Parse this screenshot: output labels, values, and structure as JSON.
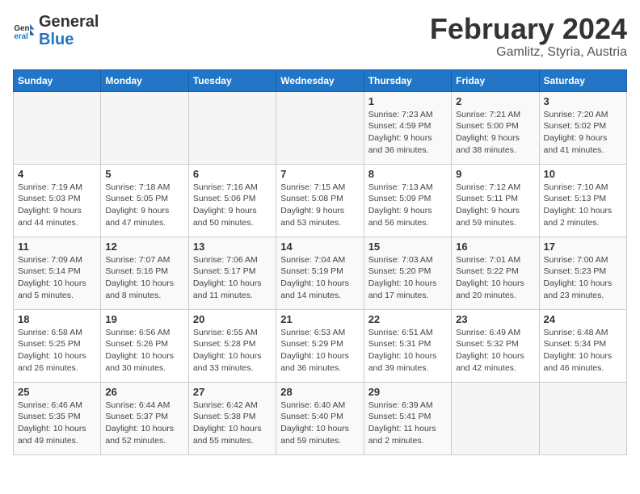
{
  "header": {
    "logo_line1": "General",
    "logo_line2": "Blue",
    "main_title": "February 2024",
    "sub_title": "Gamlitz, Styria, Austria"
  },
  "columns": [
    "Sunday",
    "Monday",
    "Tuesday",
    "Wednesday",
    "Thursday",
    "Friday",
    "Saturday"
  ],
  "weeks": [
    [
      {
        "day": "",
        "info": ""
      },
      {
        "day": "",
        "info": ""
      },
      {
        "day": "",
        "info": ""
      },
      {
        "day": "",
        "info": ""
      },
      {
        "day": "1",
        "info": "Sunrise: 7:23 AM\nSunset: 4:59 PM\nDaylight: 9 hours and 36 minutes."
      },
      {
        "day": "2",
        "info": "Sunrise: 7:21 AM\nSunset: 5:00 PM\nDaylight: 9 hours and 38 minutes."
      },
      {
        "day": "3",
        "info": "Sunrise: 7:20 AM\nSunset: 5:02 PM\nDaylight: 9 hours and 41 minutes."
      }
    ],
    [
      {
        "day": "4",
        "info": "Sunrise: 7:19 AM\nSunset: 5:03 PM\nDaylight: 9 hours and 44 minutes."
      },
      {
        "day": "5",
        "info": "Sunrise: 7:18 AM\nSunset: 5:05 PM\nDaylight: 9 hours and 47 minutes."
      },
      {
        "day": "6",
        "info": "Sunrise: 7:16 AM\nSunset: 5:06 PM\nDaylight: 9 hours and 50 minutes."
      },
      {
        "day": "7",
        "info": "Sunrise: 7:15 AM\nSunset: 5:08 PM\nDaylight: 9 hours and 53 minutes."
      },
      {
        "day": "8",
        "info": "Sunrise: 7:13 AM\nSunset: 5:09 PM\nDaylight: 9 hours and 56 minutes."
      },
      {
        "day": "9",
        "info": "Sunrise: 7:12 AM\nSunset: 5:11 PM\nDaylight: 9 hours and 59 minutes."
      },
      {
        "day": "10",
        "info": "Sunrise: 7:10 AM\nSunset: 5:13 PM\nDaylight: 10 hours and 2 minutes."
      }
    ],
    [
      {
        "day": "11",
        "info": "Sunrise: 7:09 AM\nSunset: 5:14 PM\nDaylight: 10 hours and 5 minutes."
      },
      {
        "day": "12",
        "info": "Sunrise: 7:07 AM\nSunset: 5:16 PM\nDaylight: 10 hours and 8 minutes."
      },
      {
        "day": "13",
        "info": "Sunrise: 7:06 AM\nSunset: 5:17 PM\nDaylight: 10 hours and 11 minutes."
      },
      {
        "day": "14",
        "info": "Sunrise: 7:04 AM\nSunset: 5:19 PM\nDaylight: 10 hours and 14 minutes."
      },
      {
        "day": "15",
        "info": "Sunrise: 7:03 AM\nSunset: 5:20 PM\nDaylight: 10 hours and 17 minutes."
      },
      {
        "day": "16",
        "info": "Sunrise: 7:01 AM\nSunset: 5:22 PM\nDaylight: 10 hours and 20 minutes."
      },
      {
        "day": "17",
        "info": "Sunrise: 7:00 AM\nSunset: 5:23 PM\nDaylight: 10 hours and 23 minutes."
      }
    ],
    [
      {
        "day": "18",
        "info": "Sunrise: 6:58 AM\nSunset: 5:25 PM\nDaylight: 10 hours and 26 minutes."
      },
      {
        "day": "19",
        "info": "Sunrise: 6:56 AM\nSunset: 5:26 PM\nDaylight: 10 hours and 30 minutes."
      },
      {
        "day": "20",
        "info": "Sunrise: 6:55 AM\nSunset: 5:28 PM\nDaylight: 10 hours and 33 minutes."
      },
      {
        "day": "21",
        "info": "Sunrise: 6:53 AM\nSunset: 5:29 PM\nDaylight: 10 hours and 36 minutes."
      },
      {
        "day": "22",
        "info": "Sunrise: 6:51 AM\nSunset: 5:31 PM\nDaylight: 10 hours and 39 minutes."
      },
      {
        "day": "23",
        "info": "Sunrise: 6:49 AM\nSunset: 5:32 PM\nDaylight: 10 hours and 42 minutes."
      },
      {
        "day": "24",
        "info": "Sunrise: 6:48 AM\nSunset: 5:34 PM\nDaylight: 10 hours and 46 minutes."
      }
    ],
    [
      {
        "day": "25",
        "info": "Sunrise: 6:46 AM\nSunset: 5:35 PM\nDaylight: 10 hours and 49 minutes."
      },
      {
        "day": "26",
        "info": "Sunrise: 6:44 AM\nSunset: 5:37 PM\nDaylight: 10 hours and 52 minutes."
      },
      {
        "day": "27",
        "info": "Sunrise: 6:42 AM\nSunset: 5:38 PM\nDaylight: 10 hours and 55 minutes."
      },
      {
        "day": "28",
        "info": "Sunrise: 6:40 AM\nSunset: 5:40 PM\nDaylight: 10 hours and 59 minutes."
      },
      {
        "day": "29",
        "info": "Sunrise: 6:39 AM\nSunset: 5:41 PM\nDaylight: 11 hours and 2 minutes."
      },
      {
        "day": "",
        "info": ""
      },
      {
        "day": "",
        "info": ""
      }
    ]
  ]
}
